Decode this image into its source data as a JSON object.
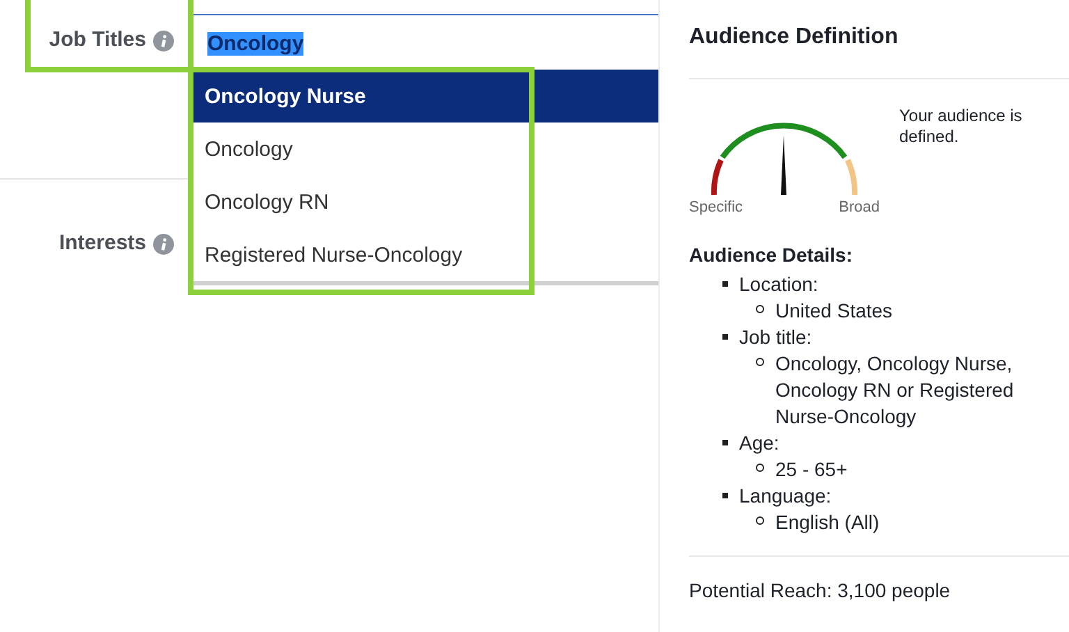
{
  "targeting": {
    "job_titles": {
      "label": "Job Titles",
      "value": "Oncology",
      "suggestions": [
        {
          "label": "Oncology Nurse",
          "highlighted": true
        },
        {
          "label": "Oncology",
          "highlighted": false
        },
        {
          "label": "Oncology RN",
          "highlighted": false
        },
        {
          "label": "Registered Nurse-Oncology",
          "highlighted": false
        }
      ]
    },
    "interests": {
      "label": "Interests"
    }
  },
  "audience": {
    "title": "Audience Definition",
    "meter": {
      "level": 0.5,
      "low_label": "Specific",
      "high_label": "Broad"
    },
    "status": "Your audience is defined.",
    "details_title": "Audience Details:",
    "details": [
      {
        "label": "Location:",
        "values": [
          "United States"
        ]
      },
      {
        "label": "Job title:",
        "values": [
          "Oncology, Oncology Nurse, Oncology RN or Registered Nurse-Oncology"
        ]
      },
      {
        "label": "Age:",
        "values": [
          "25 - 65+"
        ]
      },
      {
        "label": "Language:",
        "values": [
          "English (All)"
        ]
      }
    ],
    "reach": "Potential Reach: 3,100 people"
  }
}
